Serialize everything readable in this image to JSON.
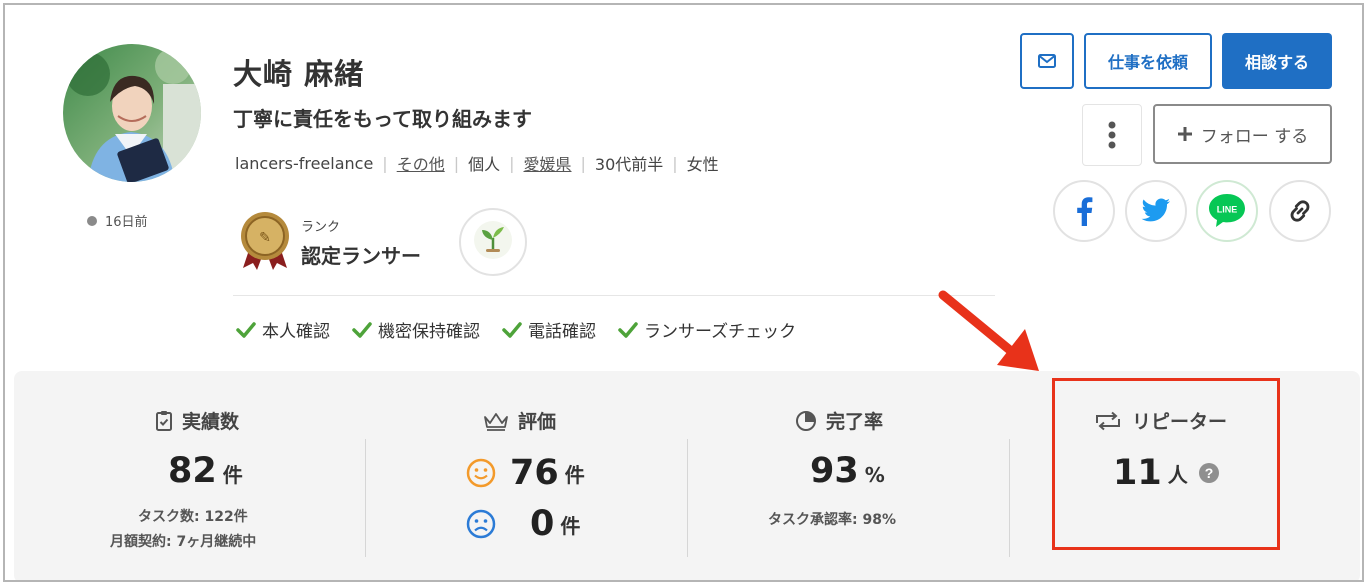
{
  "profile": {
    "name": "大崎 麻緒",
    "tagline": "丁寧に責任をもって取り組みます",
    "last_seen": "16日前",
    "meta": [
      "lancers-freelance",
      "その他",
      "個人",
      "愛媛県",
      "30代前半",
      "女性"
    ],
    "rank_label": "ランク",
    "rank_value": "認定ランサー"
  },
  "verifications": [
    "本人確認",
    "機密保持確認",
    "電話確認",
    "ランサーズチェック"
  ],
  "actions": {
    "request": "仕事を依頼",
    "consult": "相談する",
    "follow": "フォロー する",
    "line": "LINE"
  },
  "stats": {
    "jisseki": {
      "label": "実績数",
      "value": "82",
      "unit": "件",
      "sub1": "タスク数: 122件",
      "sub2": "月額契約: 7ヶ月継続中"
    },
    "hyoka": {
      "label": "評価",
      "good": "76",
      "bad": "0",
      "unit": "件"
    },
    "kanryo": {
      "label": "完了率",
      "value": "93",
      "unit": "%",
      "sub1": "タスク承認率: 98%"
    },
    "repeater": {
      "label": "リピーター",
      "value": "11",
      "unit": "人"
    }
  },
  "colors": {
    "accent": "#1f6fc4",
    "highlight": "#e8321a",
    "check": "#4ea33a"
  }
}
